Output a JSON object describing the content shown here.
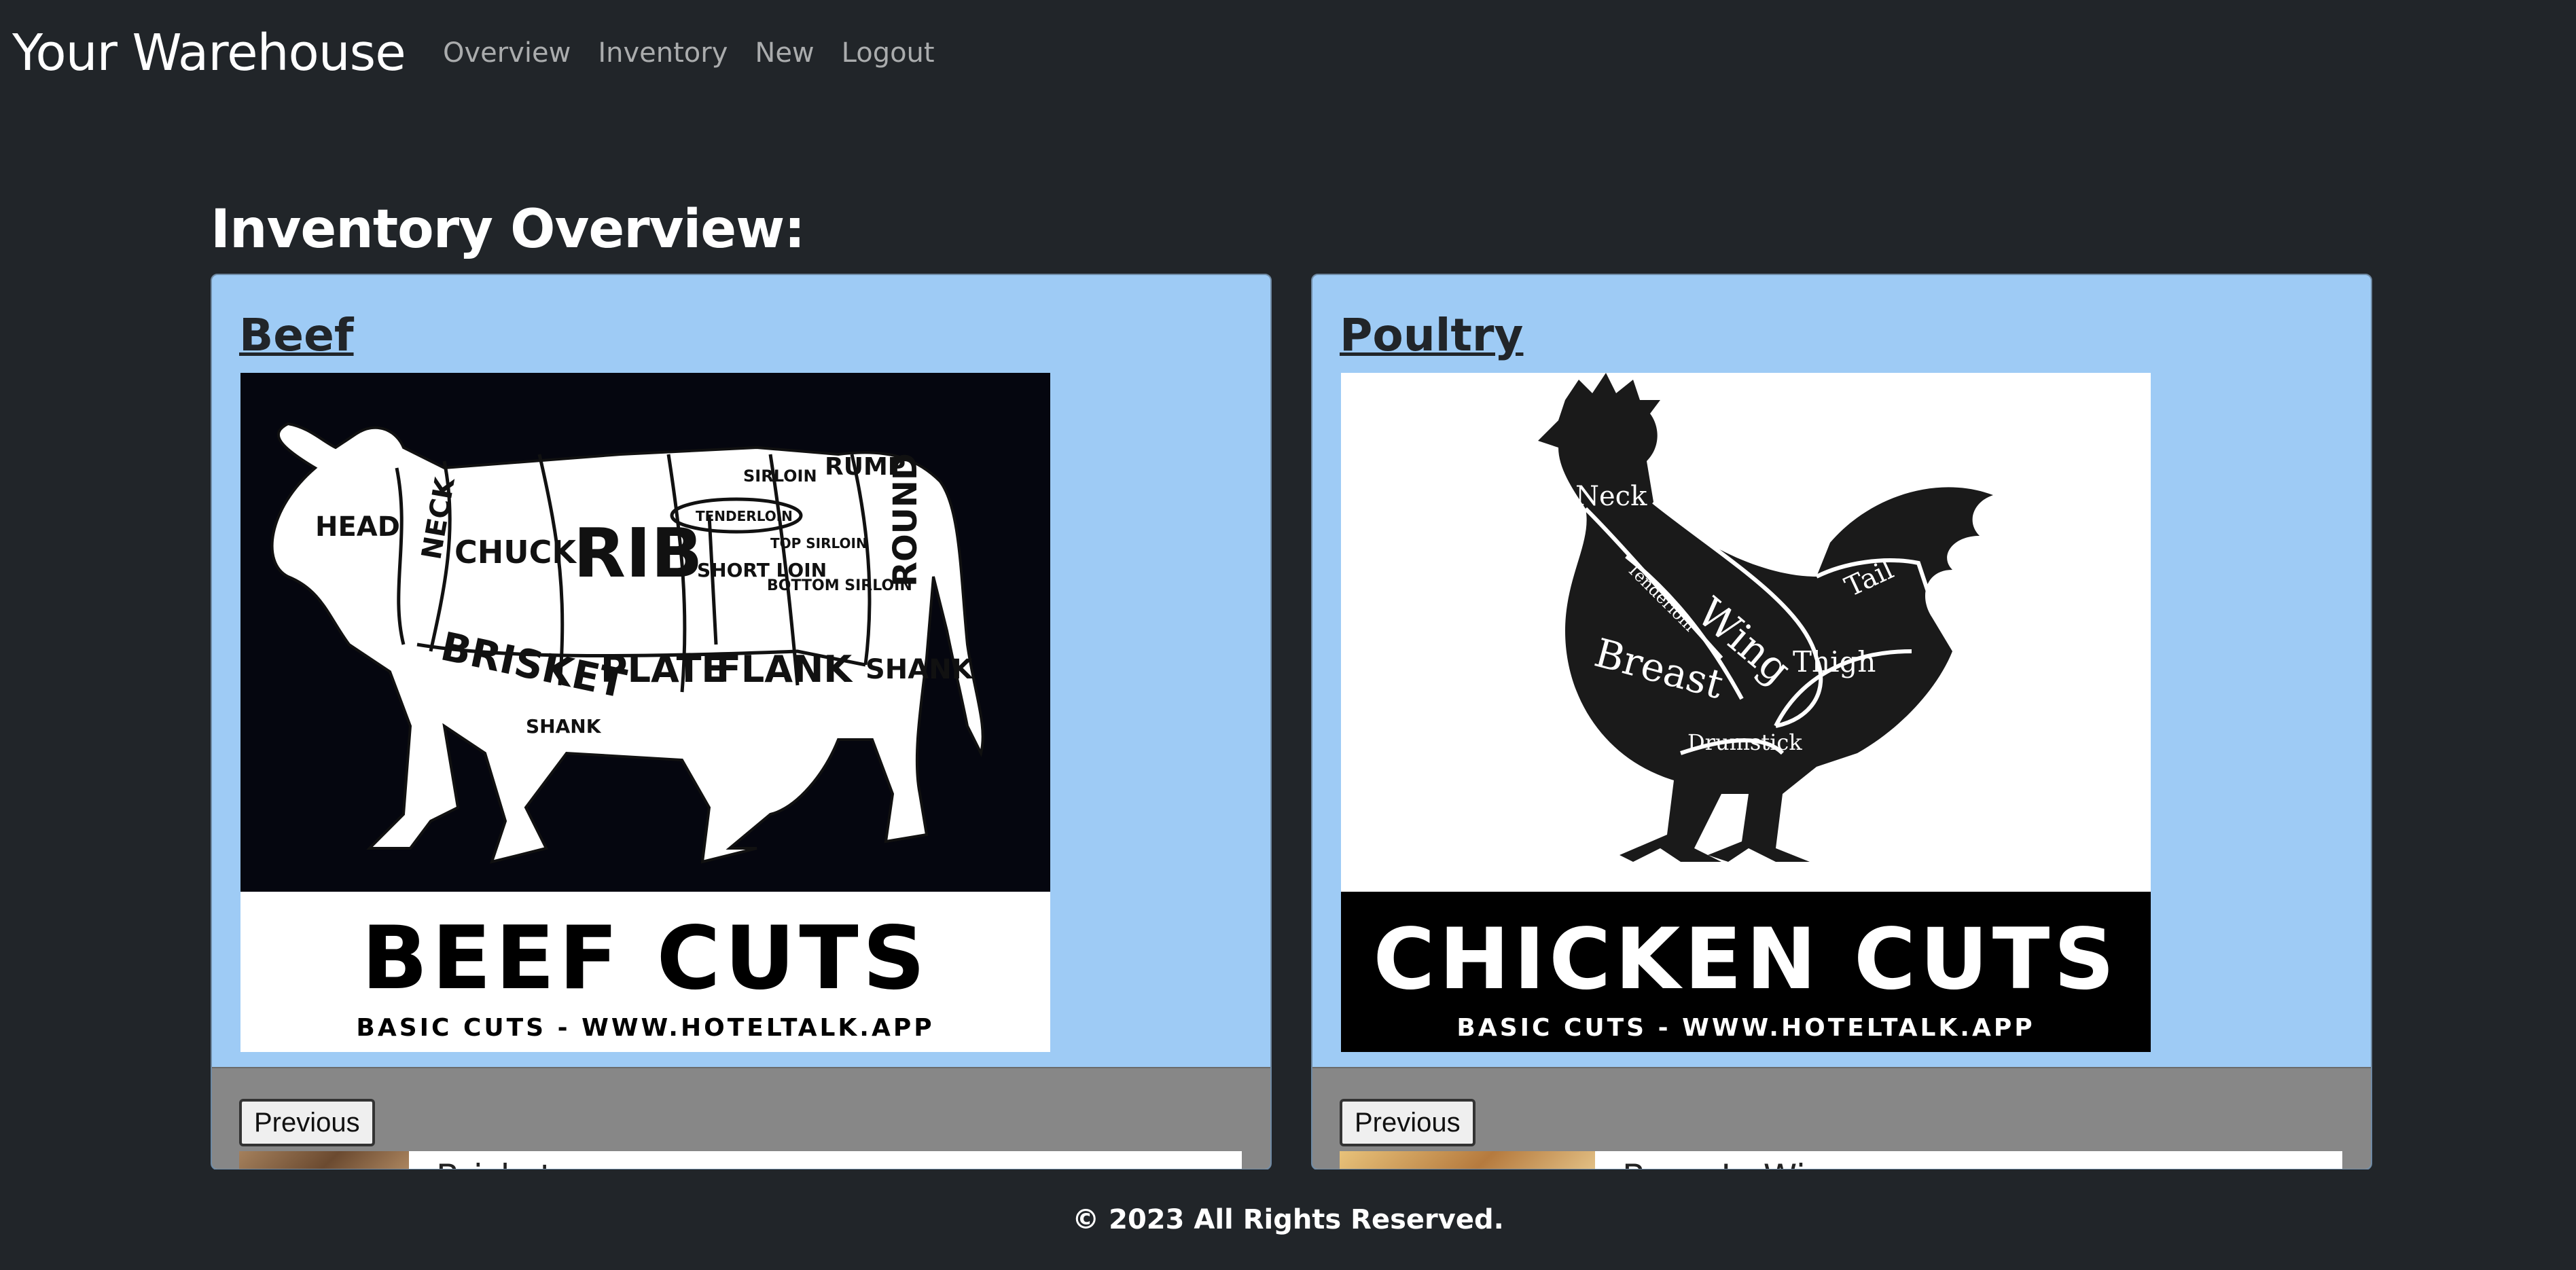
{
  "navbar": {
    "brand": "Your Warehouse",
    "links": [
      "Overview",
      "Inventory",
      "New",
      "Logout"
    ]
  },
  "page": {
    "title": "Inventory Overview:"
  },
  "cards": [
    {
      "title": "Beef",
      "image": {
        "heading": "BEEF CUTS",
        "subheading": "BASIC CUTS - WWW.HOTELTALK.APP",
        "labels": [
          "HEAD",
          "NECK",
          "CHUCK",
          "RIB",
          "SIRLOIN",
          "RUMP",
          "TENDERLOIN",
          "TOP SIRLOIN",
          "SHORT LOIN",
          "BOTTOM SIRLOIN",
          "ROUND",
          "BRISKET",
          "PLATE",
          "FLANK",
          "SHANK",
          "SHANK"
        ]
      },
      "prev_label": "Previous",
      "item_name": "Brisket"
    },
    {
      "title": "Poultry",
      "image": {
        "heading": "CHICKEN CUTS",
        "subheading": "BASIC CUTS - WWW.HOTELTALK.APP",
        "labels": [
          "Neck",
          "Tenderloin",
          "Wing",
          "Breast",
          "Tail",
          "Thigh",
          "Drumstick"
        ]
      },
      "prev_label": "Previous",
      "item_name": "Bone-In Wings"
    }
  ],
  "footer": {
    "text": "© 2023 All Rights Reserved."
  },
  "colors": {
    "background": "#212529",
    "card": "#9ecbf5",
    "card_footer": "#878787"
  }
}
